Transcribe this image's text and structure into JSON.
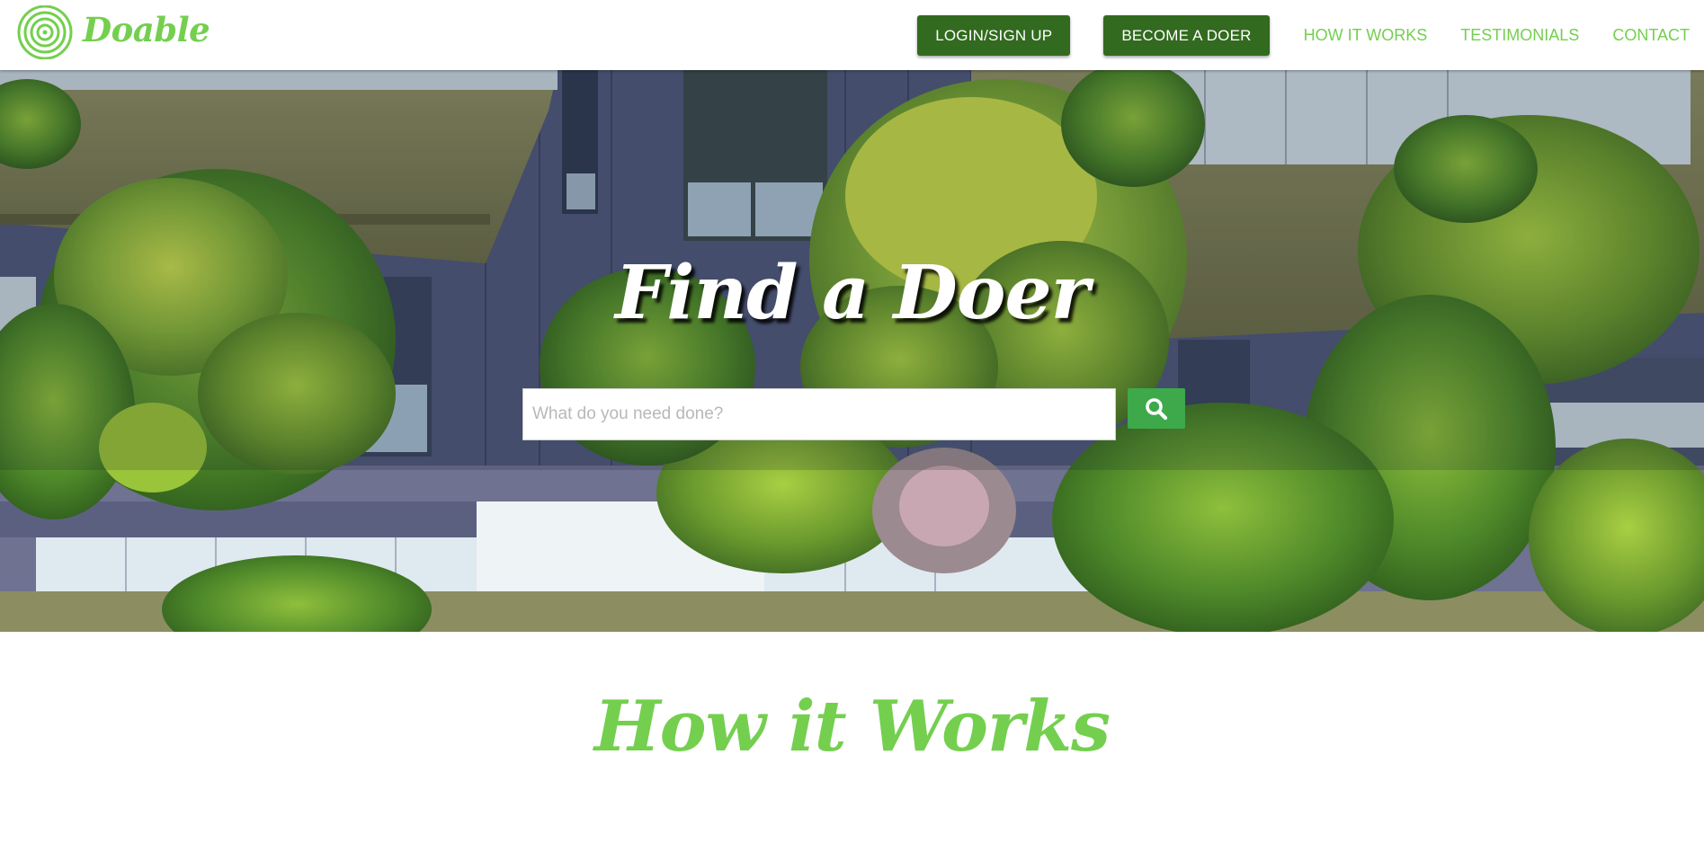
{
  "header": {
    "brand_name": "Doable",
    "brand_icon": "concentric-circles-logo-icon",
    "login_label": "LOGIN/SIGN UP",
    "become_doer_label": "BECOME A DOER",
    "nav_links": [
      "HOW IT WORKS",
      "TESTIMONIALS",
      "CONTACT"
    ]
  },
  "hero": {
    "title": "Find a Doer",
    "search": {
      "placeholder": "What do you need done?",
      "value": ""
    },
    "search_button_icon": "search-icon"
  },
  "how_it_works": {
    "title": "How it Works"
  },
  "colors": {
    "brand_green": "#74cf4f",
    "button_dark_green": "#326a1f",
    "search_button_green": "#3da94a"
  }
}
